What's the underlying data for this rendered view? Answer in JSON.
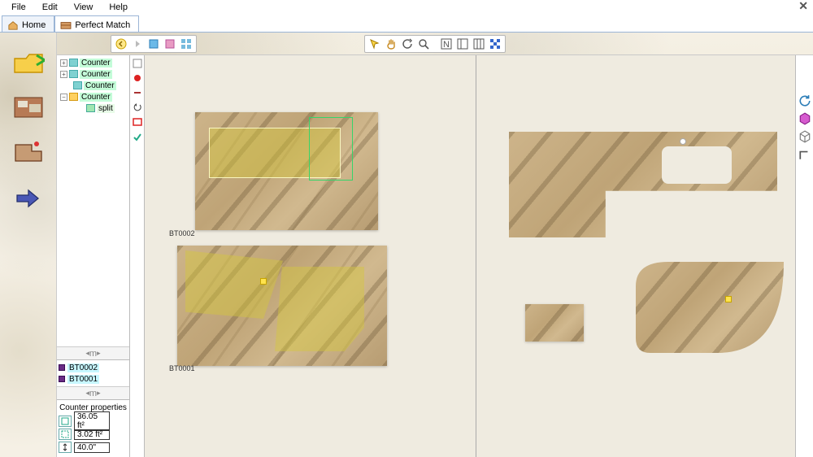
{
  "menu": {
    "file": "File",
    "edit": "Edit",
    "view": "View",
    "help": "Help"
  },
  "tabs": {
    "home": "Home",
    "perfect": "Perfect Match"
  },
  "tree": {
    "items": [
      {
        "label": "Counter"
      },
      {
        "label": "Counter"
      },
      {
        "label": "Counter"
      },
      {
        "label": "Counter"
      }
    ],
    "child_label": "split"
  },
  "bt": {
    "items": [
      "BT0002",
      "BT0001"
    ]
  },
  "props": {
    "title": "Counter properties",
    "area_value": "36.05 ft²",
    "perim_value": "3.02 ft²",
    "height_value": "40.0\""
  },
  "slabs": {
    "top_label": "BT0002",
    "bottom_label": "BT0001"
  },
  "scroll_label": "m"
}
